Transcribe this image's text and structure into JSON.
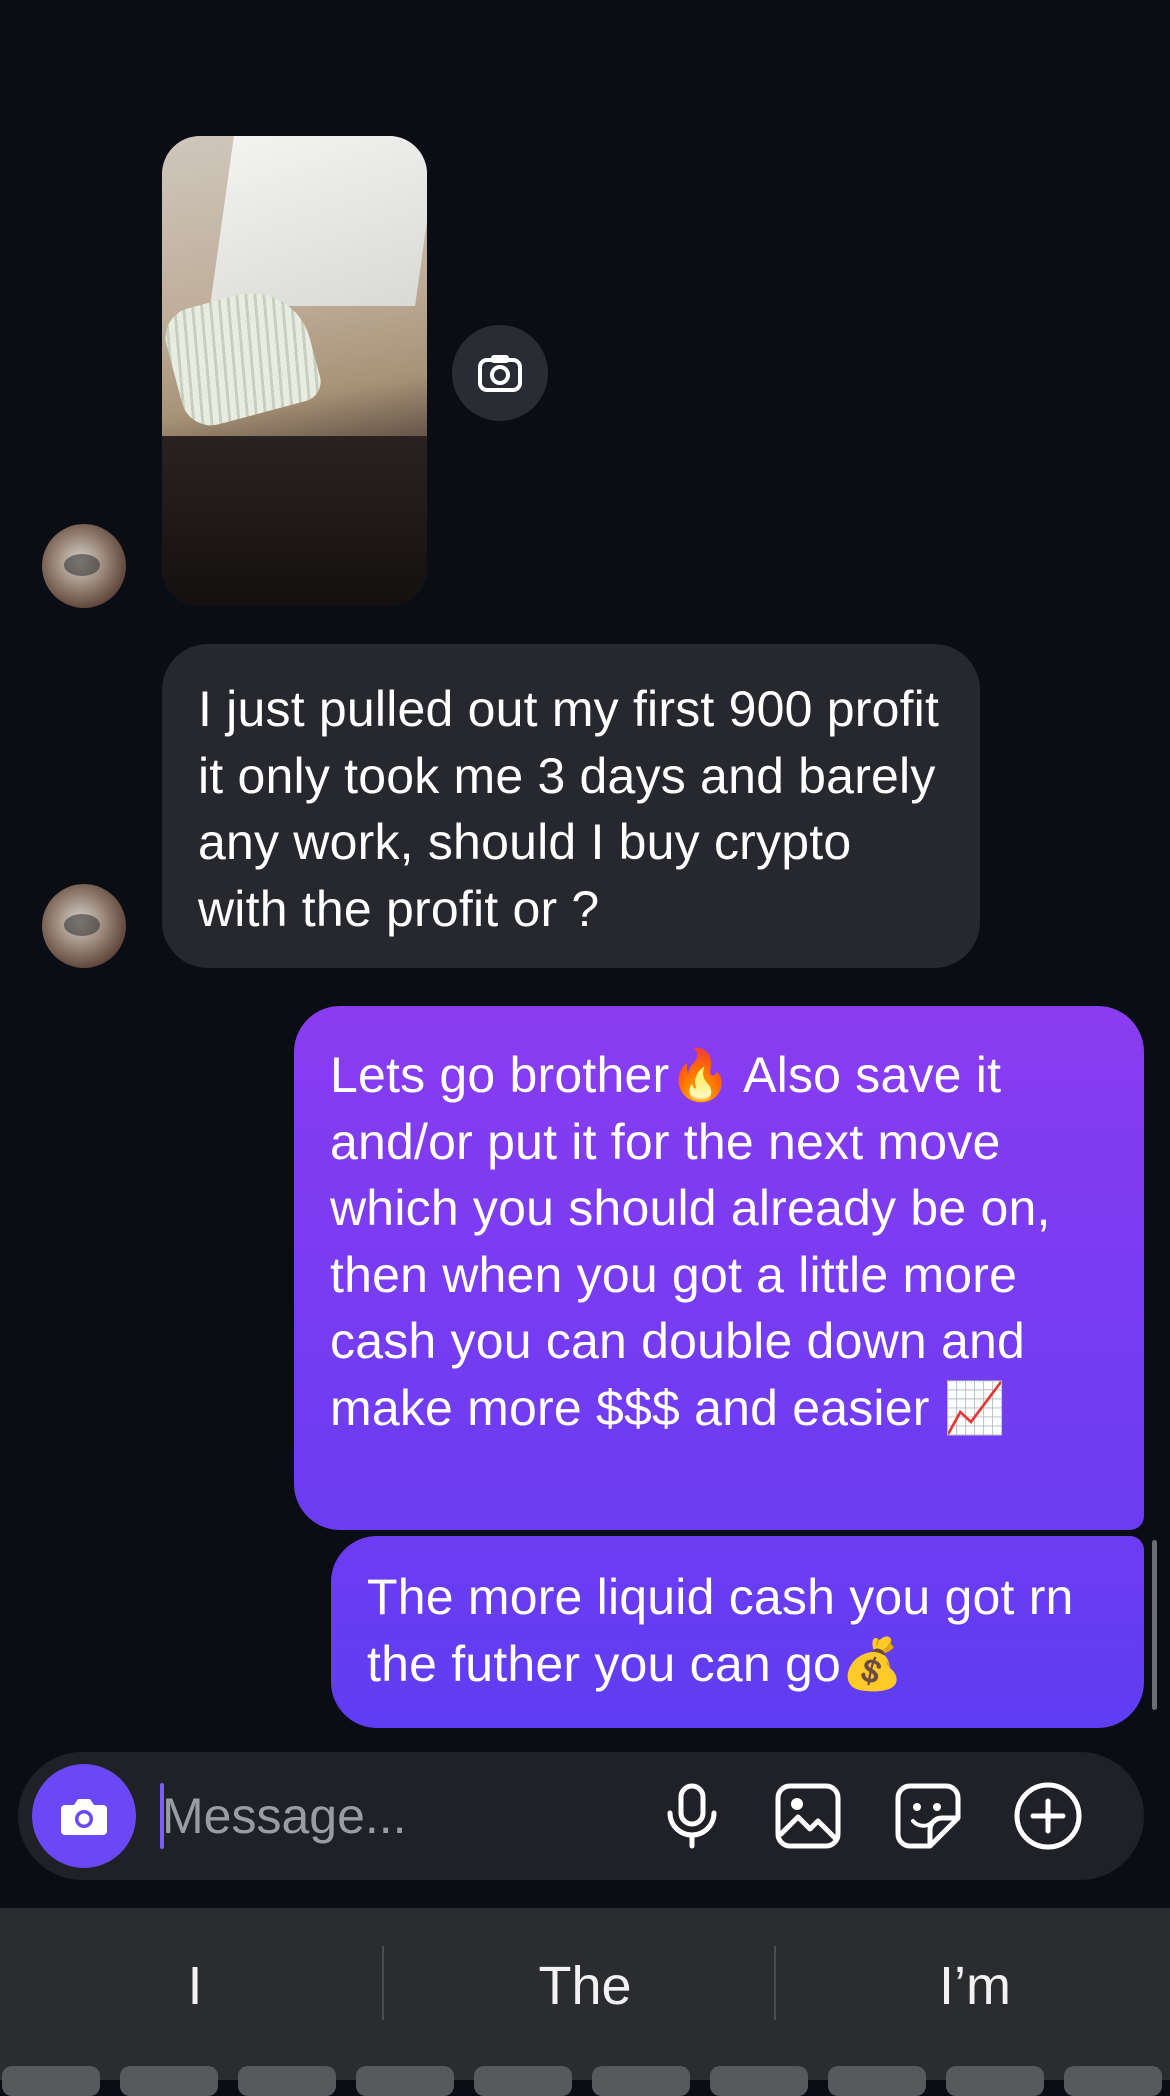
{
  "thread": {
    "incoming_text": "I just pulled out my first 900 profit it only took me 3 days and barely any work, should I buy crypto with the profit or ?",
    "outgoing": [
      "Lets go brother🔥 Also save it and/or put it for the next move which you should already be on, then when you got a little more cash you can double down and make more $$$ and easier 📈",
      "The more liquid cash you got rn the futher you can go💰"
    ]
  },
  "composer": {
    "placeholder": "Message...",
    "icons": [
      "camera-icon",
      "microphone-icon",
      "gallery-icon",
      "sticker-icon",
      "plus-circle-icon"
    ]
  },
  "keyboard": {
    "suggestions": [
      "I",
      "The",
      "I’m"
    ]
  },
  "colors": {
    "background": "#0b0d14",
    "incoming_bubble": "#26282e",
    "outgoing_bubble": "#7b3cf2",
    "accent": "#6a48f5"
  }
}
